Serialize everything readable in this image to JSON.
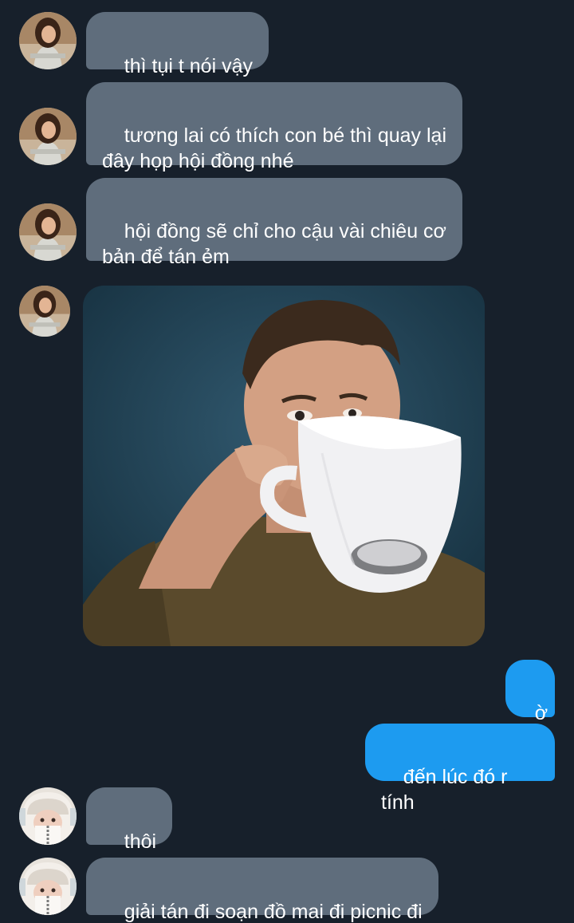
{
  "conversation": {
    "messages": [
      {
        "sender": "them",
        "avatar": "woman-avatar",
        "text": "thì tụi t nói vậy"
      },
      {
        "sender": "them",
        "avatar": "woman-avatar",
        "text": "tương lai có thích con bé thì quay lại\nđây họp hội đồng nhé"
      },
      {
        "sender": "them",
        "avatar": "woman-avatar",
        "text": "hội đồng sẽ chỉ cho cậu vài chiêu cơ\nbản để tán ẻm"
      },
      {
        "sender": "them",
        "avatar": "woman-avatar",
        "image": "man-drinking-from-giant-mug"
      },
      {
        "sender": "me",
        "text": "ờ"
      },
      {
        "sender": "me",
        "text": "đến lúc đó r tính"
      },
      {
        "sender": "other",
        "avatar": "hooded-avatar",
        "text": "thôi"
      },
      {
        "sender": "other",
        "avatar": "hooded-avatar",
        "text": "giải tán đi soạn đồ mai đi picnic đi"
      }
    ]
  },
  "colors": {
    "background": "#17202b",
    "incoming_bubble": "#5f6d7c",
    "outgoing_bubble": "#1d9bf0",
    "text": "#ffffff"
  }
}
